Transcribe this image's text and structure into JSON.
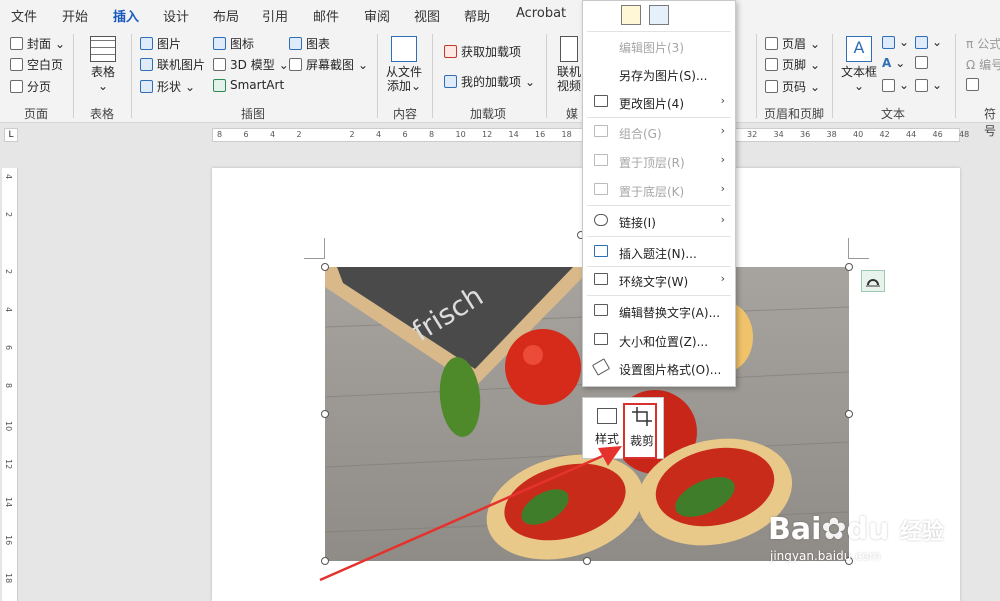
{
  "tabs": [
    "文件",
    "开始",
    "插入",
    "设计",
    "布局",
    "引用",
    "邮件",
    "审阅",
    "视图",
    "帮助",
    "Acrobat"
  ],
  "active_tab": "插入",
  "ribbon": {
    "pages": {
      "items": [
        "封面",
        "空白页",
        "分页"
      ],
      "group": "页面"
    },
    "tables": {
      "label": "表格",
      "group": "表格"
    },
    "illustrations": {
      "items": [
        "图片",
        "联机图片",
        "形状",
        "图标",
        "3D 模型",
        "SmartArt",
        "图表",
        "屏幕截图"
      ],
      "group": "插图"
    },
    "content": {
      "label": "从文件添加",
      "line1": "从文件",
      "line2": "添加",
      "group": "内容"
    },
    "addins": {
      "items": [
        "获取加载项",
        "我的加载项"
      ],
      "group": "加载项"
    },
    "media": {
      "label": "联机视频",
      "group": "媒"
    },
    "header_footer": {
      "items": [
        "页眉",
        "页脚",
        "页码"
      ],
      "group": "页眉和页脚"
    },
    "text": {
      "label": "文本框",
      "group": "文本"
    },
    "symbols": {
      "items": [
        "公式",
        "编号"
      ],
      "group": "符号"
    }
  },
  "ruler_h": [
    "8",
    "6",
    "4",
    "2",
    "",
    "2",
    "4",
    "6",
    "8",
    "10",
    "12",
    "14",
    "16",
    "18",
    "",
    "",
    "",
    "",
    "",
    "",
    "32",
    "34",
    "36",
    "38",
    "40",
    "42",
    "44",
    "46",
    "48"
  ],
  "ruler_v": [
    "4",
    "",
    "2",
    "",
    "",
    "2",
    "",
    "4",
    "",
    "6",
    "",
    "8",
    "",
    "10",
    "",
    "12",
    "",
    "14",
    "",
    "16",
    "",
    "18"
  ],
  "context_menu": {
    "items": [
      {
        "label": "编辑图片(3)",
        "disabled": true,
        "submenu": false
      },
      {
        "label": "另存为图片(S)...",
        "disabled": false,
        "submenu": false
      },
      {
        "label": "更改图片(4)",
        "disabled": false,
        "submenu": true
      },
      {
        "label": "组合(G)",
        "disabled": true,
        "submenu": true
      },
      {
        "label": "置于顶层(R)",
        "disabled": true,
        "submenu": true
      },
      {
        "label": "置于底层(K)",
        "disabled": true,
        "submenu": true
      },
      {
        "label": "链接(I)",
        "disabled": false,
        "submenu": true
      },
      {
        "label": "插入题注(N)...",
        "disabled": false,
        "submenu": false
      },
      {
        "label": "环绕文字(W)",
        "disabled": false,
        "submenu": true
      },
      {
        "label": "编辑替换文字(A)...",
        "disabled": false,
        "submenu": false
      },
      {
        "label": "大小和位置(Z)...",
        "disabled": false,
        "submenu": false
      },
      {
        "label": "设置图片格式(O)...",
        "disabled": false,
        "submenu": false
      }
    ]
  },
  "mini_toolbar": {
    "style_label": "样式",
    "crop_label": "裁剪"
  },
  "photo": {
    "chalkboard_text": "frisch"
  },
  "watermark": {
    "brand": "Bai",
    "brand2": "du",
    "sub": "经验",
    "url": "jingyan.baidu.com"
  },
  "colors": {
    "accent": "#185abd",
    "highlight": "#d9322e"
  }
}
